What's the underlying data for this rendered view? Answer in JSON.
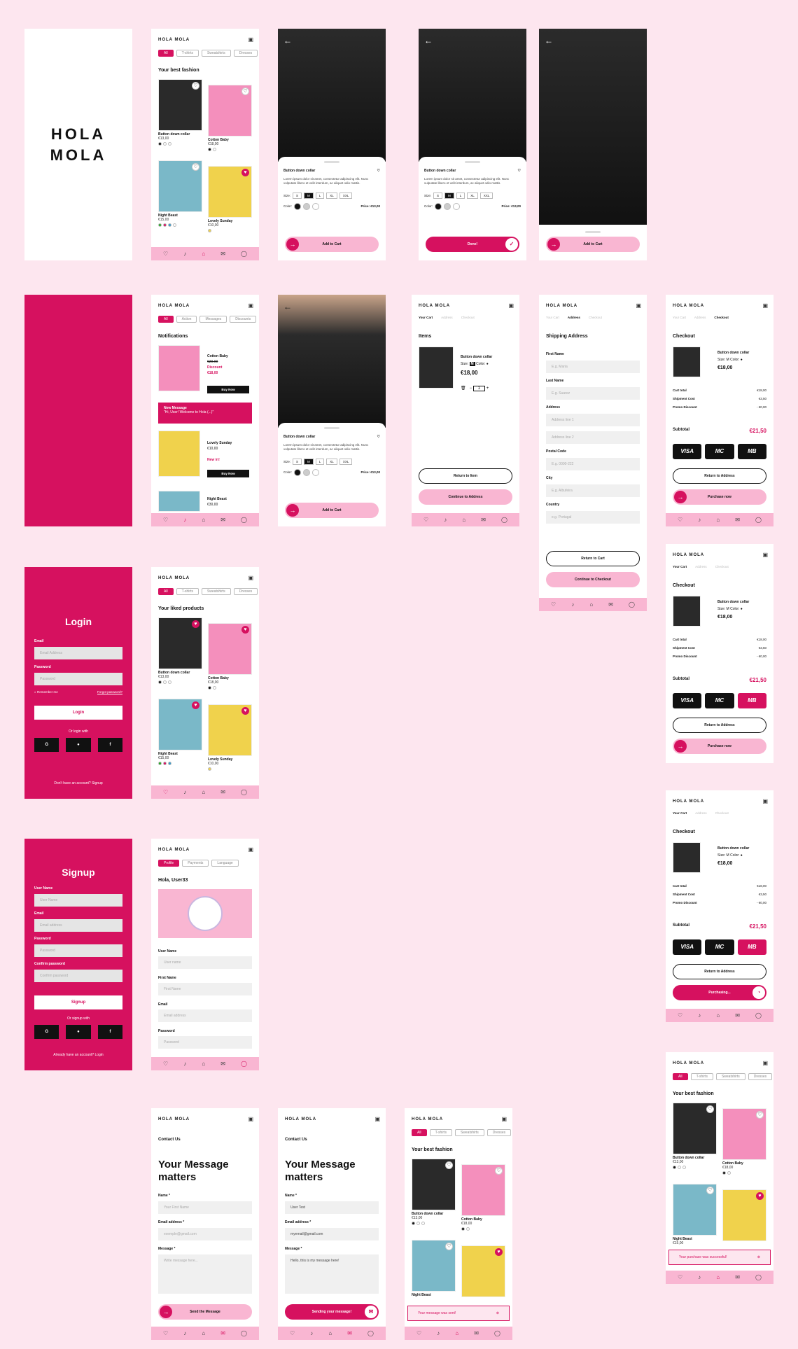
{
  "brand": {
    "logo": "HOLA MOLA",
    "accent": "#d6115f",
    "soft": "#f9b6d2",
    "bg": "#fde6ef"
  },
  "tabs": [
    "All",
    "T-shirts",
    "Sweatshirts",
    "Dresses"
  ],
  "home": {
    "title": "Your best fashion"
  },
  "liked": {
    "title": "Your liked products"
  },
  "products": [
    {
      "name": "Button down collar",
      "price": "€13,00"
    },
    {
      "name": "Cotton Baby",
      "price": "€18,00"
    },
    {
      "name": "Night Beast",
      "price": "€15,00"
    },
    {
      "name": "Lovely Sunday",
      "price": "€10,00"
    }
  ],
  "detail": {
    "title": "Button down collar",
    "desc": "Lorem ipsum dolor sit amet, consectetur adipiscing elit. Nunc vulputate libero et velit interdum, ac aliquet odio mattis.",
    "size_label": "Size:",
    "sizes": [
      "S",
      "M",
      "L",
      "XL",
      "XXL"
    ],
    "color_label": "Color:",
    "price": "Price: €13,00",
    "add": "Add to Cart",
    "done": "Done!"
  },
  "notif": {
    "tabs": [
      "All",
      "Action",
      "Messages",
      "Discounts"
    ],
    "title": "Notifications",
    "item1": {
      "name": "Cotton Baby",
      "old": "€20,00",
      "tag": "Discount",
      "price": "€18,00",
      "btn": "Buy Now"
    },
    "msg": {
      "title": "New Message",
      "text": "\"Hi, User! Welcome to Hola (...)\""
    },
    "item2": {
      "name": "Lovely Sunday",
      "price": "€10,00",
      "tag": "New in!",
      "btn": "Buy Now"
    },
    "item3": {
      "name": "Night Beast",
      "price": "€30,00"
    }
  },
  "cart": {
    "steps": [
      "Your Cart",
      "Address",
      "Checkout"
    ],
    "items": "Items",
    "name": "Button down collar",
    "size": "Size:",
    "color": "Color:",
    "price": "€18,00",
    "qty": "1",
    "back": "Return to Item",
    "next": "Continue to Address"
  },
  "ship": {
    "title": "Shipping Address",
    "fields": [
      {
        "label": "First Name",
        "ph": "E.g. Maria"
      },
      {
        "label": "Last Name",
        "ph": "E.g. Suarez"
      },
      {
        "label": "Address",
        "ph": "Address line 1"
      },
      {
        "label": "",
        "ph": "Address line 2"
      },
      {
        "label": "Postal Code",
        "ph": "E.g. 0000-222"
      },
      {
        "label": "City",
        "ph": "E.g. Albufeira"
      },
      {
        "label": "Country",
        "ph": "e.g. Portugal"
      }
    ],
    "back": "Return to Cart",
    "next": "Continue to Checkout"
  },
  "checkout": {
    "title": "Checkout",
    "total": "Cart total",
    "total_v": "€18,00",
    "ship": "Shipment Cost",
    "ship_v": "€3,50",
    "promo": "Promo Discount",
    "promo_v": "- €0,00",
    "sub": "Subtotal",
    "sub_v": "€21,50",
    "cards": [
      "VISA",
      "MC",
      "MB"
    ],
    "back": "Return to Address",
    "buy": "Purchase now",
    "buying": "Purchasing..."
  },
  "login": {
    "title": "Login",
    "email": "Email",
    "email_ph": "Email Address",
    "pw": "Password",
    "pw_ph": "Password",
    "remember": "Remember me",
    "forgot": "Forgot password?",
    "btn": "Login",
    "or": "Or login with",
    "foot": "Don't have an account? Signup"
  },
  "signup": {
    "title": "Signup",
    "user": "User Name",
    "user_ph": "User Name",
    "email": "Email",
    "email_ph": "Email address",
    "pw": "Password",
    "pw_ph": "Password",
    "cpw": "Confirm password",
    "cpw_ph": "Confirm password",
    "btn": "Signup",
    "or": "Or signup with",
    "foot": "Already have an account? Login"
  },
  "profile": {
    "tabs": [
      "Profile",
      "Payments",
      "Language"
    ],
    "hello": "Hola, User33",
    "fields": [
      {
        "label": "User Name",
        "ph": "User name"
      },
      {
        "label": "First Name",
        "ph": "First Name"
      },
      {
        "label": "Email",
        "ph": "Email address"
      },
      {
        "label": "Password",
        "ph": "Password"
      }
    ]
  },
  "contact": {
    "title": "Contact Us",
    "headline": "Your Message matters",
    "name": "Name *",
    "name_ph": "Your First Name",
    "email": "Email address *",
    "email_ph": "exemple@gmail.com",
    "msg": "Message *",
    "msg_ph": "Write message here...",
    "send": "Send the Message",
    "name_v": "User Test",
    "email_v": "myemail@gmail.com",
    "msg_v": "Hello, this is my message here!",
    "sending": "Sending your message!"
  },
  "toasts": {
    "sent": "Your message was sent!",
    "bought": "Your purchase was successful!"
  }
}
